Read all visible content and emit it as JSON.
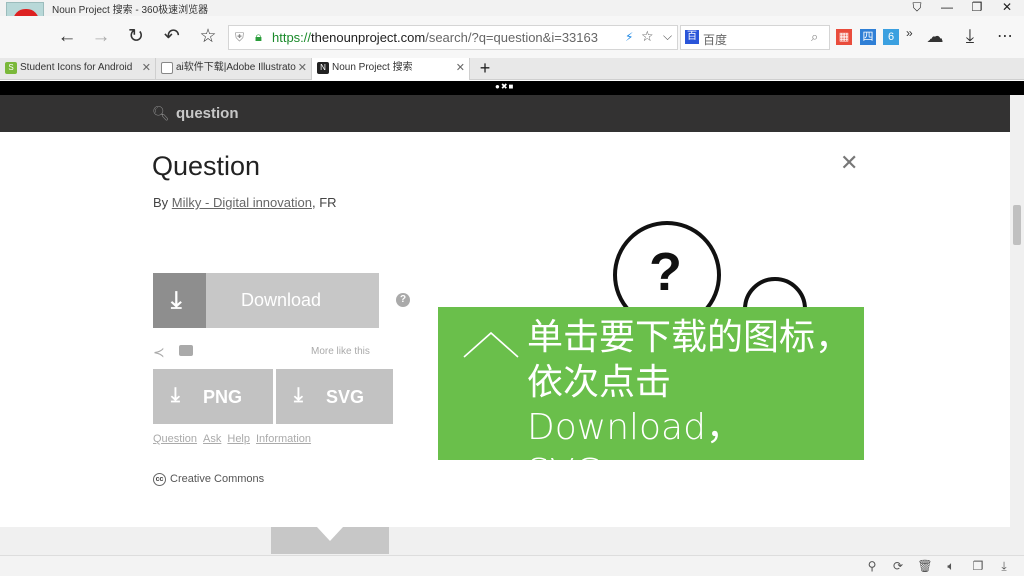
{
  "window": {
    "title": "Noun Project 搜索 - 360极速浏览器",
    "controls": [
      "shirt-icon",
      "minimize-icon",
      "maximize-icon",
      "close-icon"
    ]
  },
  "toolbar": {
    "url_scheme": "https://",
    "url_domain": "thenounproject.com",
    "url_path": "/search/?q=question&i=33163",
    "search_placeholder": "百度",
    "baidu_label": "百"
  },
  "tabs": [
    {
      "label": "Student Icons for Android",
      "icon_color": "#7ab83a",
      "icon_text": "S"
    },
    {
      "label": "ai软件下载|Adobe Illustrato",
      "icon_color": "#888888",
      "icon_text": ""
    },
    {
      "label": "Noun Project 搜索",
      "icon_color": "#222222",
      "icon_text": "N",
      "active": true
    }
  ],
  "new_tab_label": "+",
  "site": {
    "search_query": "question",
    "icon_title": "Question",
    "byline_prefix": "By ",
    "author": "Milky - Digital innovation",
    "byline_suffix": ", FR",
    "download_label": "Download",
    "help_label": "?",
    "more_like": "More like this",
    "png_label": "PNG",
    "svg_label": "SVG",
    "footer_links": [
      "Question",
      "Ask",
      "Help",
      "Information"
    ],
    "license_label": "Creative Commons",
    "cc_label": "cc",
    "close_label": "✕",
    "preview_glyph": "?"
  },
  "overlay": {
    "line1": "单击要下载的图标，",
    "line2": "依次点击Download，",
    "line3": "SVG",
    "color": "#6abf4b"
  }
}
